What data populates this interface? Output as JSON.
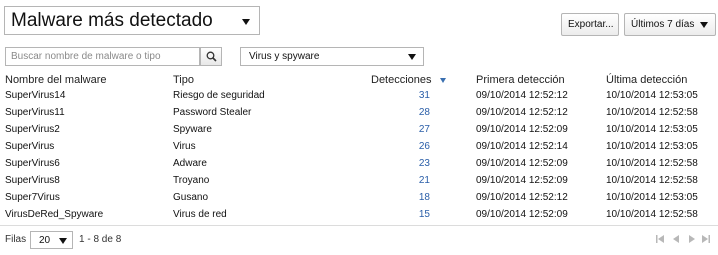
{
  "widget": {
    "title": "Malware más detectado"
  },
  "toolbar": {
    "export_label": "Exportar...",
    "range_label": "Últimos 7 días"
  },
  "filters": {
    "search_placeholder": "Buscar nombre de malware o tipo",
    "type_selected": "Virus y spyware"
  },
  "table": {
    "columns": {
      "name": "Nombre del malware",
      "type": "Tipo",
      "detections": "Detecciones",
      "first": "Primera detección",
      "last": "Última detección"
    },
    "sort": {
      "column": "detections",
      "direction": "desc"
    },
    "rows": [
      {
        "name": "SuperVirus14",
        "type": "Riesgo de seguridad",
        "detections": "31",
        "first": "09/10/2014 12:52:12",
        "last": "10/10/2014 12:53:05"
      },
      {
        "name": "SuperVirus11",
        "type": "Password Stealer",
        "detections": "28",
        "first": "09/10/2014 12:52:12",
        "last": "10/10/2014 12:52:58"
      },
      {
        "name": "SuperVirus2",
        "type": "Spyware",
        "detections": "27",
        "first": "09/10/2014 12:52:09",
        "last": "10/10/2014 12:53:05"
      },
      {
        "name": "SuperVirus",
        "type": "Virus",
        "detections": "26",
        "first": "09/10/2014 12:52:14",
        "last": "10/10/2014 12:53:05"
      },
      {
        "name": "SuperVirus6",
        "type": "Adware",
        "detections": "23",
        "first": "09/10/2014 12:52:09",
        "last": "10/10/2014 12:52:58"
      },
      {
        "name": "SuperVirus8",
        "type": "Troyano",
        "detections": "21",
        "first": "09/10/2014 12:52:09",
        "last": "10/10/2014 12:52:58"
      },
      {
        "name": "Super7Virus",
        "type": "Gusano",
        "detections": "18",
        "first": "09/10/2014 12:52:12",
        "last": "10/10/2014 12:53:05"
      },
      {
        "name": "VirusDeRed_Spyware",
        "type": "Virus de red",
        "detections": "15",
        "first": "09/10/2014 12:52:09",
        "last": "10/10/2014 12:52:58"
      }
    ]
  },
  "footer": {
    "rows_label": "Filas",
    "rows_per_page": "20",
    "range_text": "1 - 8 de 8"
  },
  "colors": {
    "link": "#2a5ea8",
    "sort_arrow": "#3a6fb0",
    "pager_disabled": "#b8b8b8"
  },
  "icons": {
    "search": "magnifier-icon",
    "pager": [
      "first-page-icon",
      "prev-page-icon",
      "next-page-icon",
      "last-page-icon"
    ]
  }
}
